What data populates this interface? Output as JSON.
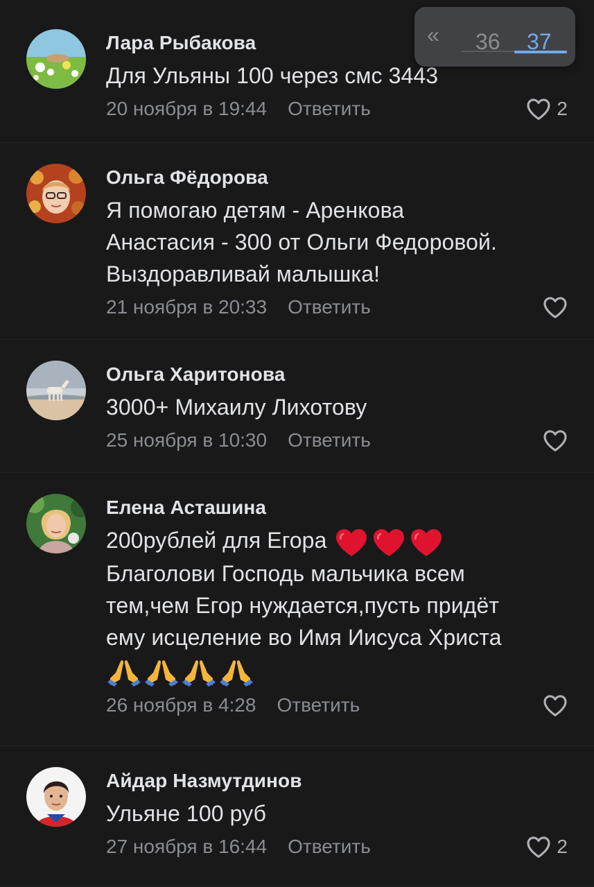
{
  "pager": {
    "back_icon": "double-chevron-left",
    "pages": [
      "36",
      "37"
    ],
    "active": "37"
  },
  "reply_label": "Ответить",
  "comments": [
    {
      "author": "Лара Рыбакова",
      "text": "Для Ульяны 100 через смс 3443",
      "date": "20 ноября в 19:44",
      "likes": "2"
    },
    {
      "author": "Ольга Фёдорова",
      "text_lines": [
        "Я помогаю детям - Аренкова",
        "Анастасия - 300 от Ольги Федоровой.",
        "Выздоравливай малышка!"
      ],
      "date": "21 ноября в 20:33",
      "likes": ""
    },
    {
      "author": "Ольга Харитонова",
      "text": "3000+ Михаилу Лихотову",
      "date": "25 ноября в 10:30",
      "likes": ""
    },
    {
      "author": "Елена Асташина",
      "text_first": "200рублей для Егора",
      "emoji_hearts": "❤️❤️❤️",
      "text_lines": [
        "Благолови Господь мальчика всем",
        "тем,чем Егор нуждается,пусть придёт",
        "ему исцеление во Имя Иисуса Христа"
      ],
      "emoji_prayers": "🙏🙏🙏🙏",
      "date": "26 ноября в 4:28",
      "likes": ""
    },
    {
      "author": "Айдар Назмутдинов",
      "text": "Ульяне 100 руб",
      "date": "27 ноября в 16:44",
      "likes": "2"
    }
  ],
  "colors": {
    "background": "#19191a",
    "text": "#e1e3e6",
    "secondary": "#8a8d91",
    "accent": "#71aaeb",
    "pager_bg": "#414245",
    "heart_emoji": "#e0132e"
  }
}
